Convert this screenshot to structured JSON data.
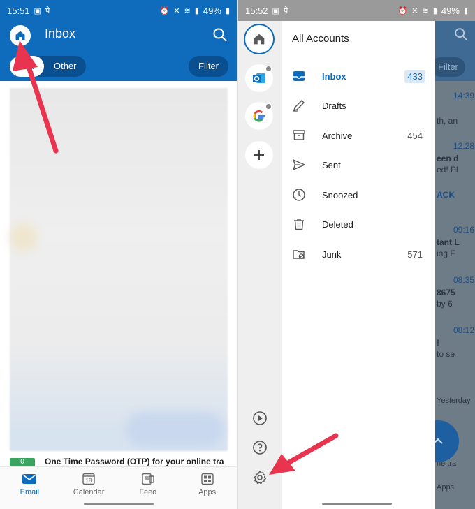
{
  "left": {
    "status": {
      "time": "15:51",
      "battery": "49%"
    },
    "appbar": {
      "title": "Inbox",
      "tabs": [
        "Focused",
        "Other"
      ],
      "visible_active_tab": "sed",
      "filter": "Filter"
    },
    "email_preview": {
      "badge": "0",
      "subject": "One Time Password (OTP) for your online tra"
    },
    "nav": [
      {
        "label": "Email",
        "icon": "email-icon"
      },
      {
        "label": "Calendar",
        "icon": "calendar-icon",
        "day": "18"
      },
      {
        "label": "Feed",
        "icon": "feed-icon"
      },
      {
        "label": "Apps",
        "icon": "apps-icon"
      }
    ]
  },
  "right": {
    "status": {
      "time": "15:52",
      "battery": "49%"
    },
    "drawer": {
      "title": "All Accounts",
      "folders": [
        {
          "label": "Inbox",
          "count": "433",
          "icon": "inbox-icon"
        },
        {
          "label": "Drafts",
          "count": "",
          "icon": "drafts-icon"
        },
        {
          "label": "Archive",
          "count": "454",
          "icon": "archive-icon"
        },
        {
          "label": "Sent",
          "count": "",
          "icon": "sent-icon"
        },
        {
          "label": "Snoozed",
          "count": "",
          "icon": "snoozed-icon"
        },
        {
          "label": "Deleted",
          "count": "",
          "icon": "deleted-icon"
        },
        {
          "label": "Junk",
          "count": "571",
          "icon": "junk-icon"
        }
      ]
    },
    "peek": {
      "filter": "Filter",
      "times": [
        "14:39",
        "12:28",
        "09:16",
        "08:35",
        "08:12"
      ],
      "snippets": [
        "th, an",
        "een d",
        "ed! Pl",
        "ACK",
        "tant L",
        "ing F",
        "8675",
        "by 6",
        "!",
        "to se",
        "Yesterday",
        "ne tra",
        "Apps"
      ]
    }
  },
  "colors": {
    "brand": "#0f6cbd",
    "arrow": "#e8344e"
  }
}
